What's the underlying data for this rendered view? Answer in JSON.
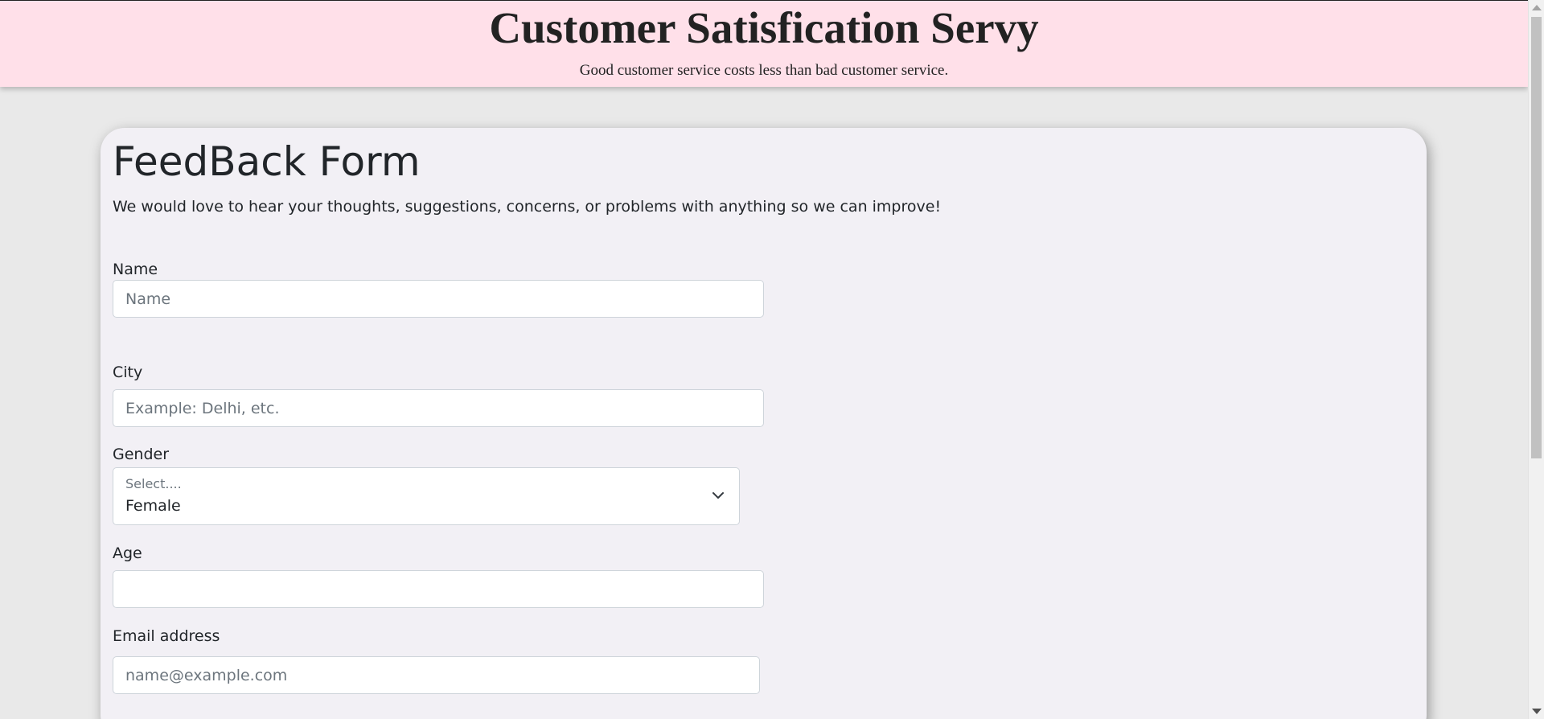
{
  "header": {
    "title": "Customer Satisfication Servy",
    "tagline": "Good customer service costs less than bad customer service."
  },
  "form": {
    "title": "FeedBack Form",
    "subtitle": "We would love to hear your thoughts, suggestions, concerns, or problems with anything so we can improve!",
    "fields": {
      "name": {
        "label": "Name",
        "placeholder": "Name",
        "value": ""
      },
      "city": {
        "label": "City",
        "placeholder": "Example: Delhi, etc.",
        "value": ""
      },
      "gender": {
        "label": "Gender",
        "floating_label": "Select....",
        "selected": "Female"
      },
      "age": {
        "label": "Age",
        "placeholder": "",
        "value": ""
      },
      "email": {
        "label": "Email address",
        "placeholder": "name@example.com",
        "value": ""
      }
    }
  },
  "icons": {
    "select_arrow": "chevron-down-icon",
    "scroll_up": "scroll-up-arrow-icon",
    "scroll_down": "scroll-down-arrow-icon"
  },
  "colors": {
    "header_bg": "#ffe0e9",
    "page_bg": "#e9e9e9",
    "card_bg": "#f2f0f5"
  }
}
